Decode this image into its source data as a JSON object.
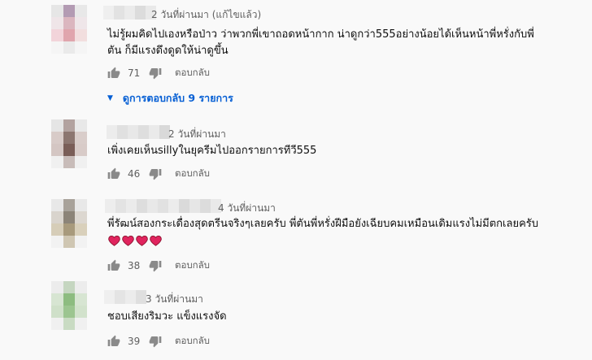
{
  "comments": [
    {
      "timestamp": "2 วันที่ผ่านมา (แก้ไขแล้ว)",
      "text_lines": [
        "ไม่รู้ผมคิดไปเองหรือป่าว ว่าพวกพี่เขาถอดหน้ากาก น่าดูกว่า555อย่างน้อยได้เห็นหน้าพี่หรั่งกับพี่",
        "ตัน ก็มีแรงดึงดูดให้น่าดูขึ้น"
      ],
      "likes": "71",
      "reply_label": "ตอบกลับ",
      "view_replies": "ดูการตอบกลับ 9 รายการ",
      "avatar_colors": [
        "#e6e6e6",
        "#b39bb3",
        "#e8e8e8",
        "#efe5e8",
        "#dbb6bf",
        "#efe6e9",
        "#f2d4da",
        "#e0a5ad",
        "#f2dede",
        "#f5f5f5",
        "#eaeaea",
        "#f5f5f5"
      ]
    },
    {
      "timestamp": "2 วันที่ผ่านมา",
      "text_lines": [
        "เพิ่งเคยเห็นsillyในยุครีมไปออกรายการทีวี555"
      ],
      "likes": "46",
      "reply_label": "ตอบกลับ",
      "avatar_colors": [
        "#e5e5e5",
        "#b2a29f",
        "#e8e8e8",
        "#d8cbc8",
        "#8c7670",
        "#d9cdca",
        "#d4c6c3",
        "#7a5e58",
        "#d8cbc8",
        "#f0f0f0",
        "#c8bcb9",
        "#f0f0f0"
      ]
    },
    {
      "timestamp": "4 วันที่ผ่านมา",
      "text_lines": [
        "พี่รัฒน์สองกระเดื่องสุดตรีนจริงๆเลยครับ พี่ตันพี่หรั่งฝีมือยังเฉียบคมเหมือนเดิมแรงไม่มีตกเลยครับ"
      ],
      "hearts": [
        "red-heart-1",
        "red-heart-2",
        "red-heart-3",
        "red-heart-4"
      ],
      "likes": "38",
      "reply_label": "ตอบกลับ",
      "avatar_colors": [
        "#e8e8e8",
        "#a8a29a",
        "#e8e8e8",
        "#d9d4cd",
        "#8c8478",
        "#dcd7d0",
        "#d6cdb8",
        "#a89a7c",
        "#d9d0bb",
        "#f2f2f2",
        "#cfc6b2",
        "#f2f2f2"
      ]
    },
    {
      "timestamp": "3 วันที่ผ่านมา",
      "text_lines": [
        "ชอบเสียงริมวะ แข็งแรงจัด"
      ],
      "likes": "39",
      "reply_label": "ตอบกลับ",
      "avatar_colors": [
        "#ececec",
        "#c5d6c0",
        "#ececec",
        "#d7e5d2",
        "#8dbc80",
        "#d7e5d2",
        "#cfe0c9",
        "#9cc590",
        "#d2e2cc",
        "#f0f0f0",
        "#c9dbc3",
        "#f0f0f0"
      ]
    }
  ]
}
